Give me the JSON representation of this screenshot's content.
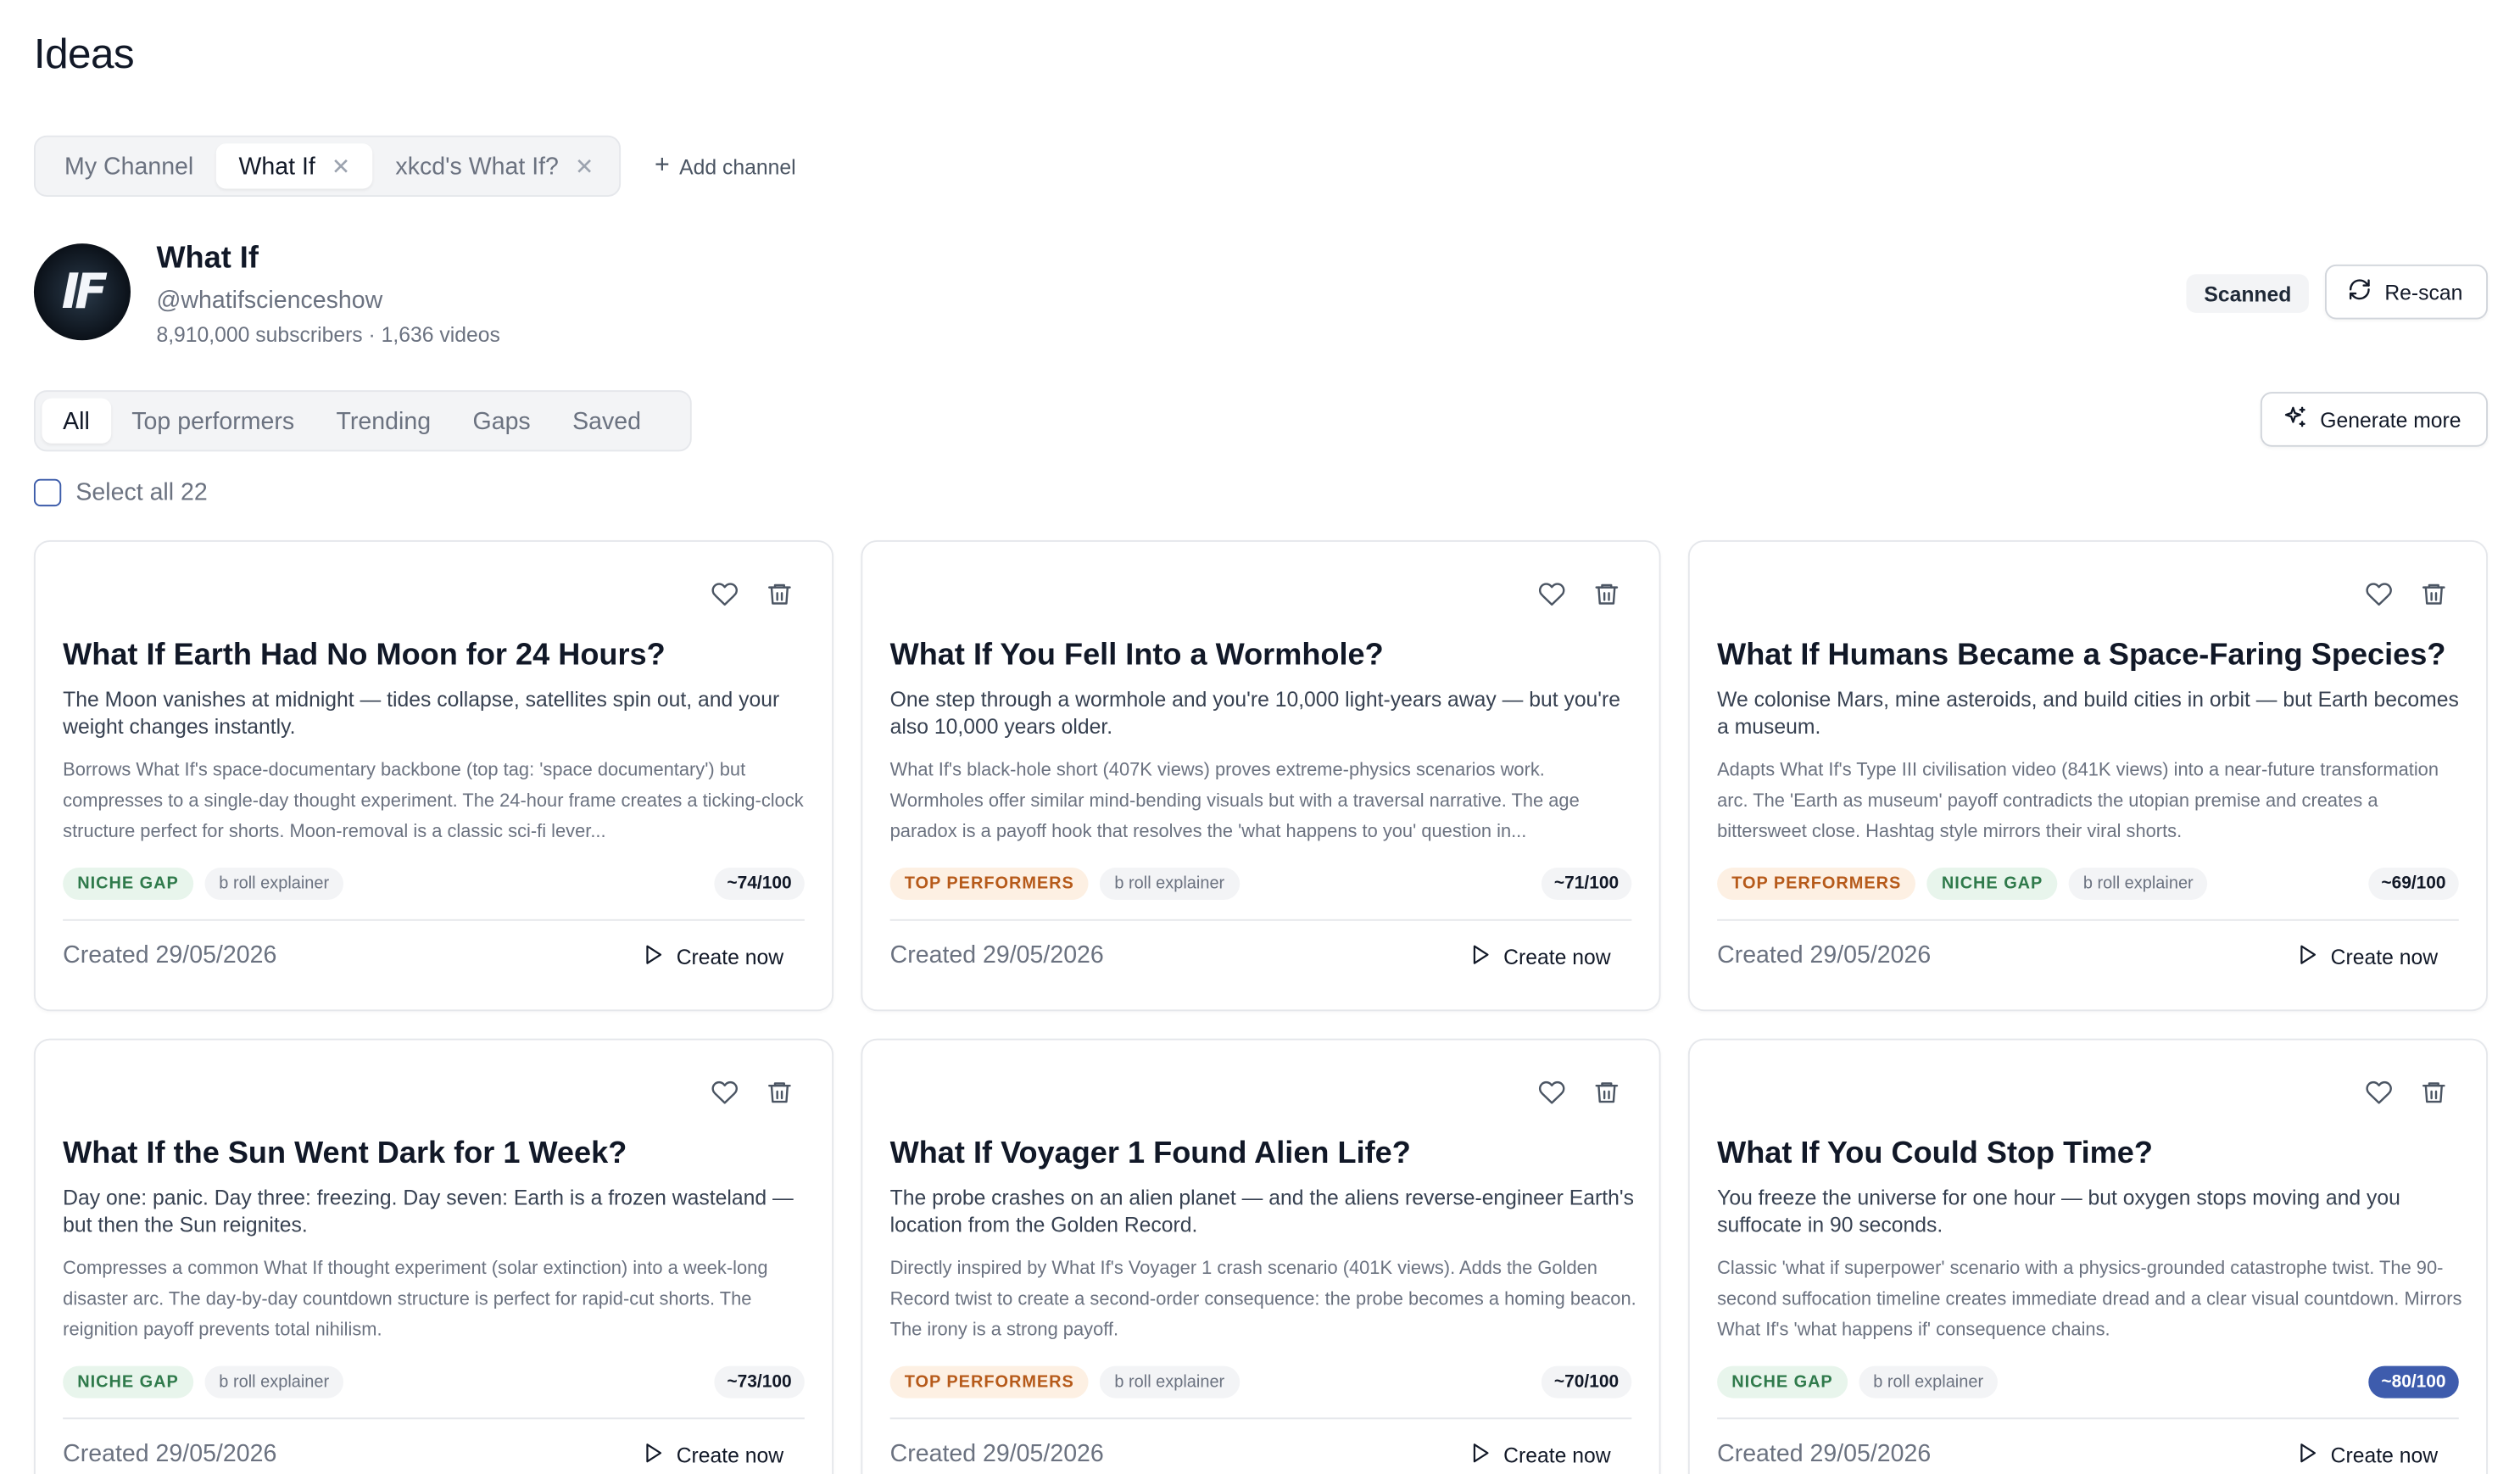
{
  "page": {
    "title": "Ideas"
  },
  "channel_tabs": [
    {
      "label": "My Channel",
      "closable": false,
      "active": false
    },
    {
      "label": "What If",
      "closable": true,
      "active": true
    },
    {
      "label": "xkcd's What If?",
      "closable": true,
      "active": false
    }
  ],
  "add_channel_label": "Add channel",
  "channel": {
    "avatar_text": "IF",
    "name": "What If",
    "handle": "@whatifscienceshow",
    "meta": "8,910,000 subscribers · 1,636 videos",
    "status": "Scanned",
    "rescan_label": "Re-scan"
  },
  "filter_tabs": [
    "All",
    "Top performers",
    "Trending",
    "Gaps",
    "Saved"
  ],
  "active_filter": "All",
  "generate_more_label": "Generate more",
  "select_all_label": "Select all 22",
  "create_label": "Create now",
  "tag_labels": {
    "niche": "NICHE GAP",
    "top": "TOP PERFORMERS",
    "format": "b roll explainer"
  },
  "colors": {
    "accent": "#3e5cad",
    "niche_text": "#2f7a4b",
    "niche_bg": "#e8f5ec",
    "top_text": "#b65a1a",
    "top_bg": "#fdf0e3"
  },
  "ideas": [
    {
      "title": "What If Earth Had No Moon for 24 Hours?",
      "hook": "The Moon vanishes at midnight — tides collapse, satellites spin out, and your weight changes instantly.",
      "reason": "Borrows What If's space-documentary backbone (top tag: 'space documentary') but compresses to a single-day thought experiment. The 24-hour frame creates a ticking-clock structure perfect for shorts. Moon-removal is a classic sci-fi lever...",
      "tags": [
        "niche",
        "format"
      ],
      "score": "~74/100",
      "created": "Created 29/05/2026"
    },
    {
      "title": "What If You Fell Into a Wormhole?",
      "hook": "One step through a wormhole and you're 10,000 light-years away — but you're also 10,000 years older.",
      "reason": "What If's black-hole short (407K views) proves extreme-physics scenarios work. Wormholes offer similar mind-bending visuals but with a traversal narrative. The age paradox is a payoff hook that resolves the 'what happens to you' question in...",
      "tags": [
        "top",
        "format"
      ],
      "score": "~71/100",
      "created": "Created 29/05/2026"
    },
    {
      "title": "What If Humans Became a Space-Faring Species?",
      "hook": "We colonise Mars, mine asteroids, and build cities in orbit — but Earth becomes a museum.",
      "reason": "Adapts What If's Type III civilisation video (841K views) into a near-future transformation arc. The 'Earth as museum' payoff contradicts the utopian premise and creates a bittersweet close. Hashtag style mirrors their viral shorts.",
      "tags": [
        "top",
        "niche",
        "format"
      ],
      "score": "~69/100",
      "created": "Created 29/05/2026"
    },
    {
      "title": "What If the Sun Went Dark for 1 Week?",
      "hook": "Day one: panic. Day three: freezing. Day seven: Earth is a frozen wasteland — but then the Sun reignites.",
      "reason": "Compresses a common What If thought experiment (solar extinction) into a week-long disaster arc. The day-by-day countdown structure is perfect for rapid-cut shorts. The reignition payoff prevents total nihilism.",
      "tags": [
        "niche",
        "format"
      ],
      "score": "~73/100",
      "created": "Created 29/05/2026"
    },
    {
      "title": "What If Voyager 1 Found Alien Life?",
      "hook": "The probe crashes on an alien planet — and the aliens reverse-engineer Earth's location from the Golden Record.",
      "reason": "Directly inspired by What If's Voyager 1 crash scenario (401K views). Adds the Golden Record twist to create a second-order consequence: the probe becomes a homing beacon. The irony is a strong payoff.",
      "tags": [
        "top",
        "format"
      ],
      "score": "~70/100",
      "created": "Created 29/05/2026"
    },
    {
      "title": "What If You Could Stop Time?",
      "hook": "You freeze the universe for one hour — but oxygen stops moving and you suffocate in 90 seconds.",
      "reason": "Classic 'what if superpower' scenario with a physics-grounded catastrophe twist. The 90-second suffocation timeline creates immediate dread and a clear visual countdown. Mirrors What If's 'what happens if' consequence chains.",
      "tags": [
        "niche",
        "format"
      ],
      "score": "~80/100",
      "score_highlight": true,
      "created": "Created 29/05/2026"
    }
  ]
}
